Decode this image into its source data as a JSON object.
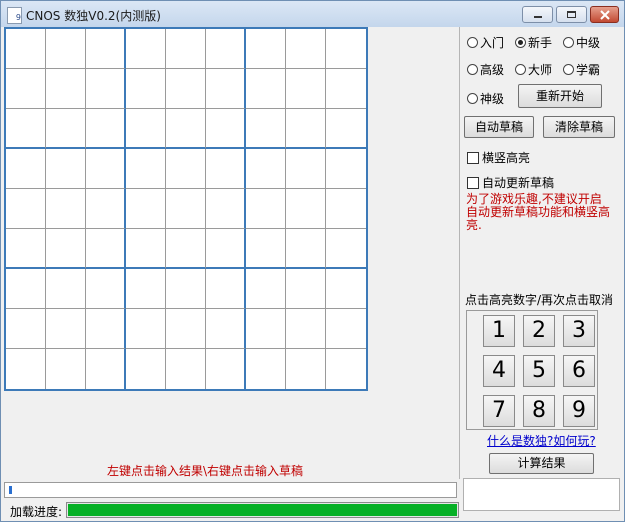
{
  "window": {
    "title": "CNOS 数独V0.2(内测版)",
    "icon_name": "app-sudoku-icon",
    "controls": [
      "minimize-icon",
      "maximize-icon",
      "close-icon"
    ]
  },
  "board": {
    "rows": 9,
    "cols": 9,
    "box_line_color": "#3d7ab8"
  },
  "hint": "左键点击输入结果\\右键点击输入草稿",
  "difficulty": {
    "options": [
      "入门",
      "新手",
      "中级",
      "高级",
      "大师",
      "学霸",
      "神级"
    ],
    "selected": "新手"
  },
  "buttons": {
    "restart": "重新开始",
    "auto_draft": "自动草稿",
    "clear_draft": "清除草稿",
    "calculate": "计算结果"
  },
  "checkboxes": {
    "highlight": {
      "label": "横竖高亮",
      "checked": false
    },
    "auto_update": {
      "label": "自动更新草稿",
      "checked": false
    }
  },
  "warning": "为了游戏乐趣,不建议开启自动更新草稿功能和横竖高亮.",
  "number_pad": {
    "label": "点击高亮数字/再次点击取消",
    "numbers": [
      "1",
      "2",
      "3",
      "4",
      "5",
      "6",
      "7",
      "8",
      "9"
    ]
  },
  "help_link": "什么是数独?如何玩?",
  "loading": {
    "label": "加载进度:",
    "progress": 1.0,
    "color": "#06b025"
  }
}
